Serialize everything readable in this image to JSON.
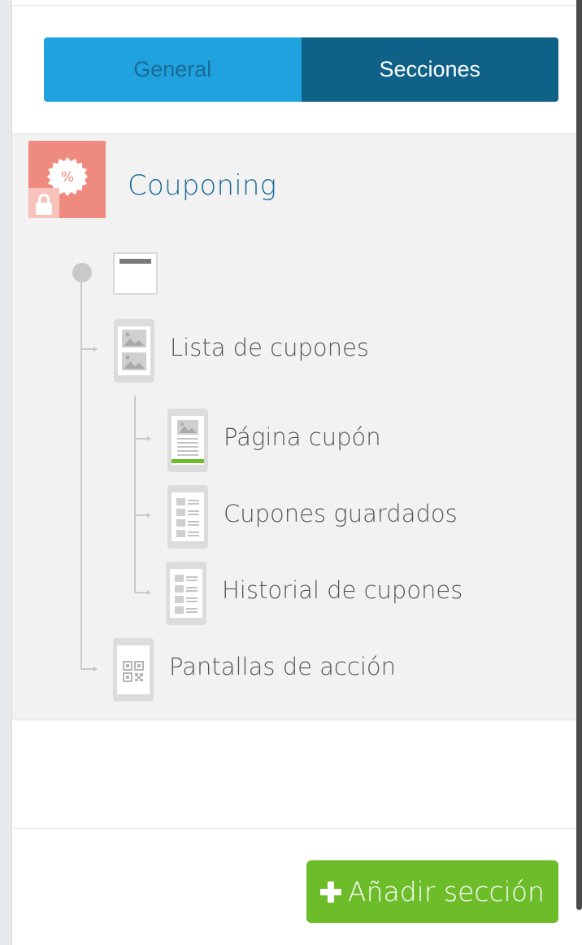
{
  "tabs": {
    "general": "General",
    "secciones": "Secciones",
    "active": "Secciones"
  },
  "module": {
    "title": "Couponing",
    "icon": "percent-badge-icon",
    "locked": true
  },
  "tree": {
    "header_icon": "header-bar-icon",
    "items": [
      {
        "label": "Lista de cupones",
        "icon": "image-list-icon"
      },
      {
        "label": "Página cupón",
        "icon": "coupon-page-icon"
      },
      {
        "label": "Cupones guardados",
        "icon": "list-rows-icon"
      },
      {
        "label": "Historial de cupones",
        "icon": "list-rows-icon"
      },
      {
        "label": "Pantallas de acción",
        "icon": "qr-code-icon"
      }
    ]
  },
  "actions": {
    "add_section": "Añadir sección"
  },
  "colors": {
    "tab_general": "#1fa2dd",
    "tab_active": "#0f6187",
    "module_icon": "#ef8b7e",
    "title": "#1d6a95",
    "add_button": "#6dbd2b"
  }
}
